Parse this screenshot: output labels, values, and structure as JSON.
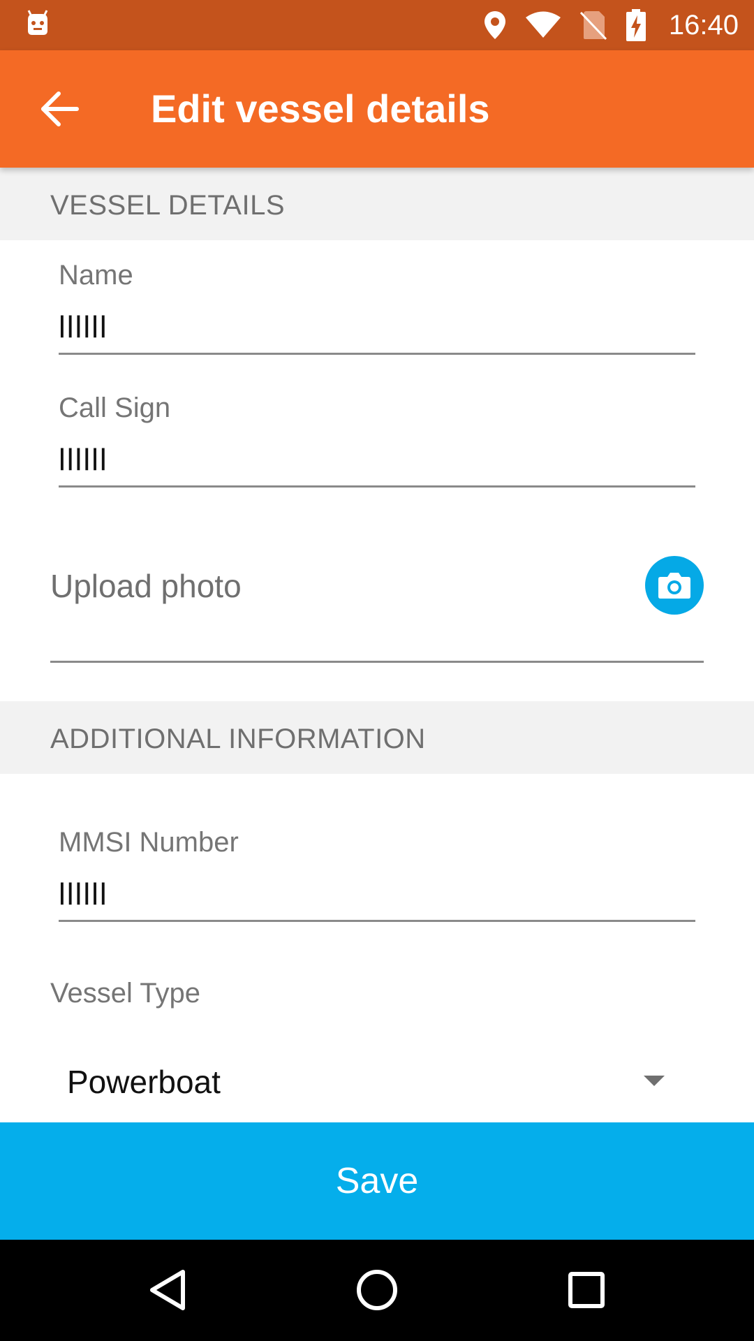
{
  "status_bar": {
    "time": "16:40",
    "icons": [
      "android-notification-icon",
      "location-pin-icon",
      "wifi-icon",
      "no-sim-icon",
      "battery-charging-icon"
    ]
  },
  "app_bar": {
    "title": "Edit vessel details",
    "back_icon": "arrow-back-icon"
  },
  "sections": {
    "vessel_details": "VESSEL DETAILS",
    "additional_information": "ADDITIONAL INFORMATION"
  },
  "fields": {
    "name": {
      "label": "Name",
      "value": "llllll"
    },
    "call_sign": {
      "label": "Call Sign",
      "value": "llllll"
    },
    "mmsi": {
      "label": "MMSI Number",
      "value": "llllll"
    }
  },
  "upload": {
    "label": "Upload photo",
    "icon": "camera-icon"
  },
  "vessel_type": {
    "label": "Vessel Type",
    "selected": "Powerboat"
  },
  "save_label": "Save",
  "colors": {
    "status_bar": "#c4531c",
    "app_bar": "#f46a25",
    "accent_blue": "#05aeeb",
    "section_bg": "#f2f2f2"
  },
  "nav_bar": {
    "icons": [
      "back-triangle-icon",
      "home-circle-icon",
      "recents-square-icon"
    ]
  }
}
